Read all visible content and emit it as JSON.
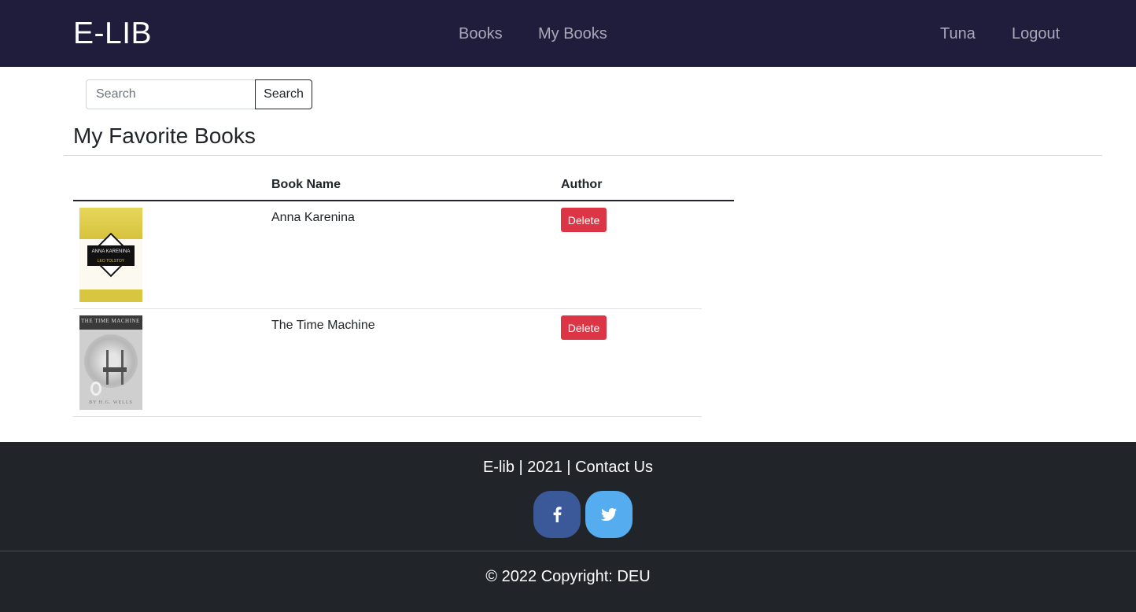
{
  "navbar": {
    "brand": "E-LIB",
    "links": [
      "Books",
      "My Books"
    ],
    "user": "Tuna",
    "logout": "Logout"
  },
  "search": {
    "placeholder": "Search",
    "value": "",
    "button_label": "Search"
  },
  "page": {
    "title": "My Favorite Books"
  },
  "table": {
    "headers": [
      "",
      "Book Name",
      "Author"
    ],
    "rows": [
      {
        "name": "Anna Karenina",
        "action": "Delete",
        "cover_title": "ANNA KARENINA",
        "cover_author": "LEO TOLSTOY"
      },
      {
        "name": "The Time Machine",
        "action": "Delete",
        "cover_title": "THE TIME MACHINE",
        "cover_author": "BY H.G. WELLS"
      }
    ]
  },
  "footer": {
    "text": "E-lib | 2021 | Contact Us",
    "social": [
      {
        "icon": "facebook-icon",
        "color": "#3b5998"
      },
      {
        "icon": "twitter-icon",
        "color": "#55acee"
      }
    ],
    "copyright": "© 2022 Copyright: DEU"
  },
  "colors": {
    "navbar_bg": "#201d3c",
    "footer_bg": "#212529",
    "danger": "#dc3545"
  }
}
